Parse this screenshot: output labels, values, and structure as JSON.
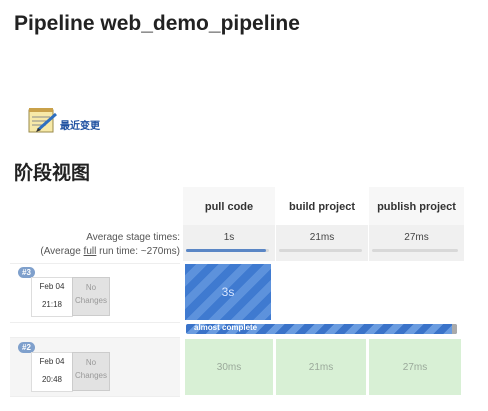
{
  "page": {
    "title": "Pipeline web_demo_pipeline",
    "section_title": "阶段视图"
  },
  "sidebar_link": {
    "label": "最近变更"
  },
  "stage_view": {
    "stages": [
      "pull code",
      "build project",
      "publish project"
    ],
    "average": {
      "label_line1": "Average stage times:",
      "label_line2_prefix": "(Average ",
      "label_line2_full": "full",
      "label_line2_suffix": " run time: ~270ms)",
      "times": [
        "1s",
        "21ms",
        "27ms"
      ],
      "bar_fill_percent": [
        96,
        0,
        0
      ]
    },
    "runs": [
      {
        "badge": "#3",
        "date": "Feb 04",
        "time": "21:18",
        "changes": "No Changes",
        "cells": [
          "3s",
          "",
          ""
        ],
        "state": "running",
        "progress_label": "almost complete",
        "progress_percent": 98
      },
      {
        "badge": "#2",
        "date": "Feb 04",
        "time": "20:48",
        "changes": "No Changes",
        "cells": [
          "30ms",
          "21ms",
          "27ms"
        ],
        "state": "success"
      }
    ]
  },
  "colors": {
    "running": "#3f7ad0",
    "success": "#d8f0d5",
    "link": "#1d4fa0"
  }
}
